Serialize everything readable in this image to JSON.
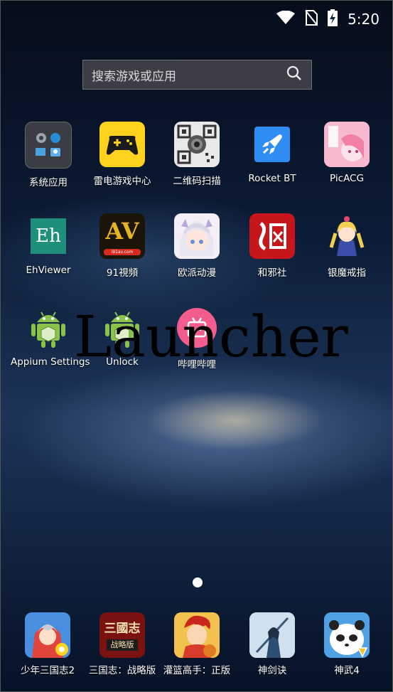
{
  "status_bar": {
    "time": "5:20",
    "icons": [
      "wifi-icon",
      "no-sim-icon",
      "battery-charging-icon"
    ]
  },
  "search": {
    "placeholder": "搜索游戏或应用",
    "icon": "search-icon"
  },
  "apps": [
    {
      "label": "系统应用"
    },
    {
      "label": "雷电游戏中心"
    },
    {
      "label": "二维码扫描"
    },
    {
      "label": "Rocket BT"
    },
    {
      "label": "PicACG"
    },
    {
      "label": "EhViewer",
      "icon_text": "Eh"
    },
    {
      "label": "91視頻",
      "icon_text": "AV",
      "icon_subtext": "i91av.com"
    },
    {
      "label": "欧派动漫"
    },
    {
      "label": "和邪社"
    },
    {
      "label": "银魔戒指"
    },
    {
      "label": "Appium Settings"
    },
    {
      "label": "Unlock"
    },
    {
      "label": "哔哩哔哩"
    }
  ],
  "overlay_text": "Launcher",
  "dock": [
    {
      "label": "少年三国志2"
    },
    {
      "label": "三国志：战略版",
      "icon_text": "三國志",
      "icon_subtext": "战略版"
    },
    {
      "label": "灌篮高手：正版"
    },
    {
      "label": "神剑诀"
    },
    {
      "label": "神武4"
    }
  ],
  "colors": {
    "wallpaper": "#0c1d38",
    "leidian_yellow": "#ffd21e",
    "rocket_blue": "#2f8cf2",
    "eh_teal": "#1e8f7a",
    "bilibili_pink": "#f25d8e"
  }
}
